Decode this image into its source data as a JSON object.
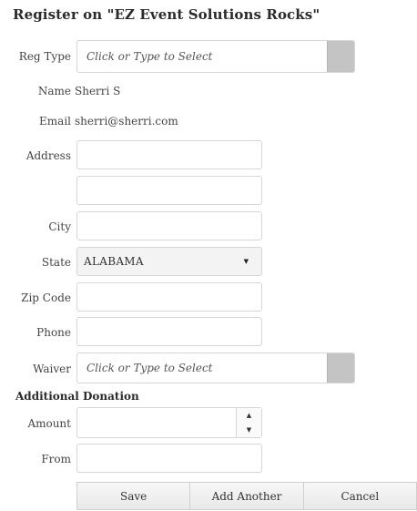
{
  "header": {
    "title": "Register on \"EZ Event Solutions Rocks\""
  },
  "form": {
    "reg_type": {
      "label": "Reg Type",
      "placeholder": "Click or Type to Select",
      "value": ""
    },
    "name": {
      "label": "Name",
      "value": "Sherri S"
    },
    "email": {
      "label": "Email",
      "value": "sherri@sherri.com"
    },
    "address": {
      "label": "Address",
      "line1": "",
      "line2": ""
    },
    "city": {
      "label": "City",
      "value": ""
    },
    "state": {
      "label": "State",
      "value": "ALABAMA"
    },
    "zip": {
      "label": "Zip Code",
      "value": ""
    },
    "phone": {
      "label": "Phone",
      "value": ""
    },
    "waiver": {
      "label": "Waiver",
      "placeholder": "Click or Type to Select",
      "value": ""
    }
  },
  "donation": {
    "heading": "Additional Donation",
    "amount": {
      "label": "Amount",
      "value": ""
    },
    "from": {
      "label": "From",
      "value": ""
    }
  },
  "actions": {
    "save": "Save",
    "add_another": "Add Another",
    "cancel": "Cancel"
  },
  "icons": {
    "dropdown_button": "dropdown-button",
    "select_caret": "caret-down-icon",
    "spinner_up": "triangle-up-icon",
    "spinner_down": "triangle-down-icon"
  },
  "colors": {
    "dropdown_button": "#c4c4c4",
    "select_background": "#f3f3f3",
    "border": "#d6d6d6"
  }
}
